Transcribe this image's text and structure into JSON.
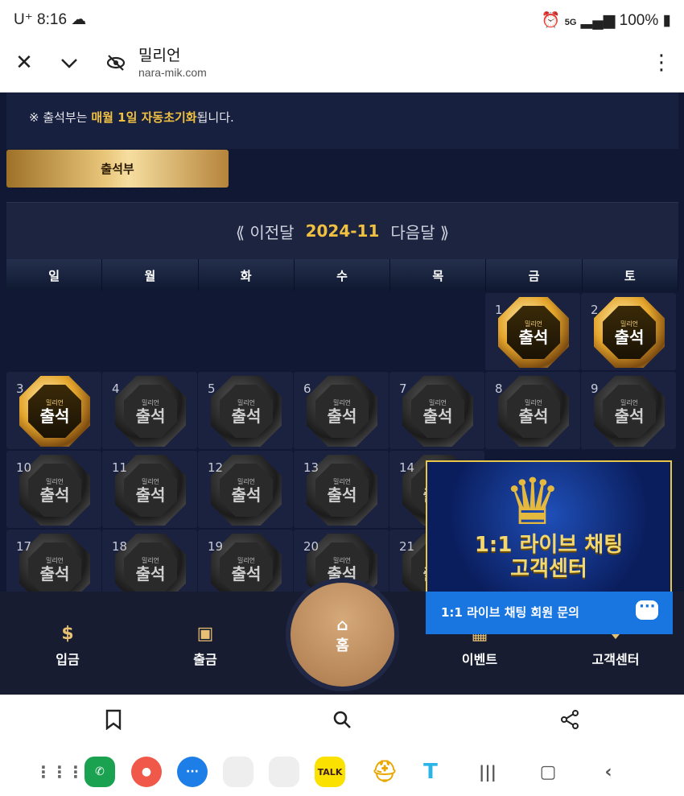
{
  "status_bar": {
    "carrier": "U⁺",
    "time": "8:16",
    "battery": "100%",
    "network": "5G"
  },
  "browser": {
    "site_title": "밀리언",
    "site_url": "nara-mik.com",
    "icons": [
      "close-icon",
      "chevron-down-icon",
      "eye-off-icon",
      "more-vertical-icon"
    ]
  },
  "notice": {
    "line2_prefix": "※ 출석부는 ",
    "line2_highlight": "매월 1일 자동초기화",
    "line2_suffix": "됩니다."
  },
  "attendance_button": "출석부",
  "calendar": {
    "prev": "⟪ 이전달",
    "month": "2024-11",
    "next": "다음달 ⟫",
    "weekdays": [
      "일",
      "월",
      "화",
      "수",
      "목",
      "금",
      "토"
    ],
    "badge_word": "출석",
    "badge_logo": "밀리언",
    "days": [
      {
        "d": "",
        "state": "empty"
      },
      {
        "d": "",
        "state": "empty"
      },
      {
        "d": "",
        "state": "empty"
      },
      {
        "d": "",
        "state": "empty"
      },
      {
        "d": "",
        "state": "empty"
      },
      {
        "d": "1",
        "state": "gold"
      },
      {
        "d": "2",
        "state": "gold"
      },
      {
        "d": "3",
        "state": "gold"
      },
      {
        "d": "4",
        "state": "gray"
      },
      {
        "d": "5",
        "state": "gray"
      },
      {
        "d": "6",
        "state": "gray"
      },
      {
        "d": "7",
        "state": "gray"
      },
      {
        "d": "8",
        "state": "gray"
      },
      {
        "d": "9",
        "state": "gray"
      },
      {
        "d": "10",
        "state": "gray"
      },
      {
        "d": "11",
        "state": "gray"
      },
      {
        "d": "12",
        "state": "gray"
      },
      {
        "d": "13",
        "state": "gray"
      },
      {
        "d": "14",
        "state": "gray"
      },
      {
        "d": "",
        "state": "empty"
      },
      {
        "d": "",
        "state": "empty"
      },
      {
        "d": "17",
        "state": "gray"
      },
      {
        "d": "18",
        "state": "gray"
      },
      {
        "d": "19",
        "state": "gray"
      },
      {
        "d": "20",
        "state": "gray"
      },
      {
        "d": "21",
        "state": "gray"
      },
      {
        "d": "",
        "state": "empty"
      },
      {
        "d": "",
        "state": "empty"
      }
    ]
  },
  "bottom_nav": {
    "deposit": "입금",
    "withdraw": "출금",
    "home": "홈",
    "event": "이벤트",
    "support": "고객센터"
  },
  "chat_popup": {
    "title_line1": "1:1 라이브 채팅",
    "title_line2": "고객센터",
    "bar_label": "1:1 라이브 채팅 회원 문의"
  },
  "dock": {
    "kakao_label": "TALK"
  }
}
